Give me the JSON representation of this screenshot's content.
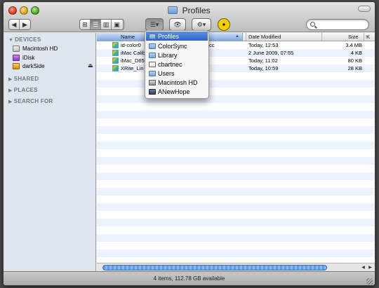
{
  "window": {
    "title": "Profiles"
  },
  "toolbar": {
    "back_label": "◀",
    "forward_label": "▶",
    "view_buttons": [
      "⊞",
      "☰",
      "▥",
      "▣"
    ],
    "path_button_label": "☰▾",
    "quicklook_label": "👁",
    "action_label": "⚙▾",
    "search_placeholder": ""
  },
  "sidebar": {
    "devices_header": "DEVICES",
    "devices": [
      {
        "label": "Macintosh HD",
        "icon": "hard-drive-icon"
      },
      {
        "label": "iDisk",
        "icon": "idisk-icon"
      },
      {
        "label": "darkSide",
        "icon": "external-drive-icon",
        "eject": "⏏"
      }
    ],
    "shared_header": "SHARED",
    "places_header": "PLACES",
    "search_header": "SEARCH FOR"
  },
  "columns": {
    "name": "Name",
    "date": "Date Modified",
    "size": "Size",
    "more": "K"
  },
  "files": [
    {
      "name": "id-color0",
      "name_tail": "cc",
      "date": "Today, 12:53",
      "size": "3.4 MB"
    },
    {
      "name": "iMac Calib",
      "date": "2 June 2009, 07:55",
      "size": "4 KB"
    },
    {
      "name": "iMac_D65",
      "date": "Today, 11:02",
      "size": "80 KB"
    },
    {
      "name": "XRite_Lin",
      "date": "Today, 10:59",
      "size": "28 KB"
    }
  ],
  "path_menu": [
    {
      "label": "Profiles",
      "icon": "folder-icon",
      "selected": true
    },
    {
      "label": "ColorSync",
      "icon": "folder-icon"
    },
    {
      "label": "Library",
      "icon": "folder-icon"
    },
    {
      "label": "cbartnec",
      "icon": "home-icon"
    },
    {
      "label": "Users",
      "icon": "folder-icon"
    },
    {
      "label": "Macintosh HD",
      "icon": "hard-drive-icon"
    },
    {
      "label": "ANewHope",
      "icon": "computer-icon"
    }
  ],
  "status": {
    "text": "4 items, 112.78 GB available"
  }
}
